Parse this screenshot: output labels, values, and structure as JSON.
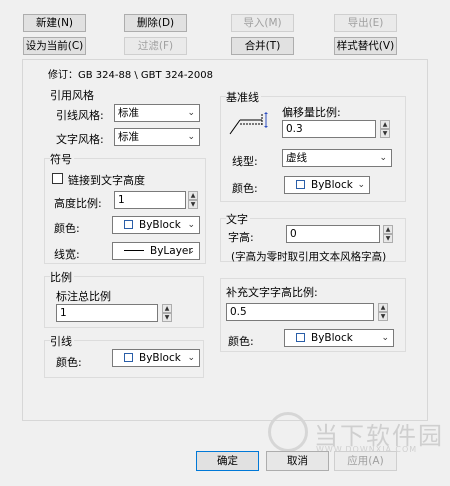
{
  "toolbar": {
    "new": "新建(N)",
    "delete": "删除(D)",
    "import": "导入(M)",
    "export": "导出(E)",
    "set_current": "设为当前(C)",
    "filter": "过滤(F)",
    "merge": "合并(T)",
    "style_replace": "样式替代(V)"
  },
  "revision": "修订：GB 324-88 \\ GBT 324-2008",
  "leader_style": {
    "title": "引用风格",
    "leader_label": "引线风格:",
    "leader_value": "标准",
    "text_label": "文字风格:",
    "text_value": "标准"
  },
  "symbol": {
    "title": "符号",
    "link_text_height": "链接到文字高度",
    "height_ratio_label": "高度比例:",
    "height_ratio_value": "1",
    "color_label": "颜色:",
    "color_value": "ByBlock",
    "linewidth_label": "线宽:",
    "linewidth_value": "ByLayer"
  },
  "scale": {
    "title": "比例",
    "total_label": "标注总比例",
    "total_value": "1"
  },
  "leader": {
    "title": "引线",
    "color_label": "颜色:",
    "color_value": "ByBlock"
  },
  "baseline": {
    "title": "基准线",
    "offset_label": "偏移量比例:",
    "offset_value": "0.3",
    "linetype_label": "线型:",
    "linetype_value": "虚线",
    "color_label": "颜色:",
    "color_value": "ByBlock"
  },
  "text": {
    "title": "文字",
    "height_label": "字高:",
    "height_value": "0",
    "note": "(字高为零时取引用文本风格字高)"
  },
  "fill_text": {
    "title": "补充文字字高比例:",
    "value": "0.5",
    "color_label": "颜色:",
    "color_value": "ByBlock"
  },
  "footer": {
    "ok": "确定",
    "cancel": "取消",
    "apply": "应用(A)"
  },
  "watermark": {
    "text": "当下软件园",
    "sub": "WWW.DOWNXIA.COM"
  }
}
